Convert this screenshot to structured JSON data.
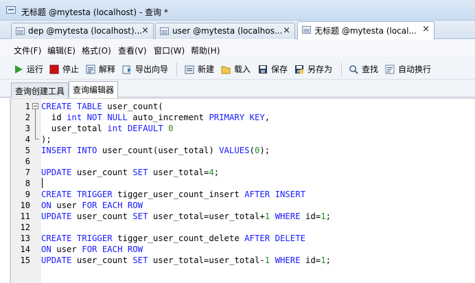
{
  "window": {
    "title": "无标题 @mytesta (localhost) - 查询 *"
  },
  "tabs": [
    {
      "label": "dep @mytesta (localhost)...",
      "close": "×",
      "active": false
    },
    {
      "label": "user @mytesta (localhos...",
      "close": "×",
      "active": false
    },
    {
      "label": "无标题 @mytesta (local...",
      "close": "×",
      "active": true
    }
  ],
  "menu": [
    {
      "label": "文件(F)"
    },
    {
      "label": "编辑(E)"
    },
    {
      "label": "格式(O)"
    },
    {
      "label": "查看(V)"
    },
    {
      "label": "窗口(W)"
    },
    {
      "label": "帮助(H)"
    }
  ],
  "toolbar": {
    "run": "运行",
    "stop": "停止",
    "explain": "解释",
    "export_wizard": "导出向导",
    "new": "新建",
    "load": "载入",
    "save": "保存",
    "save_as": "另存为",
    "find": "查找",
    "word_wrap": "自动换行"
  },
  "sub_tabs": [
    {
      "label": "查询创建工具",
      "active": false
    },
    {
      "label": "查询编辑器",
      "active": true
    }
  ],
  "colors": {
    "keyword": "#1a1aff",
    "number": "#1b8c1b",
    "run_icon": "#2f9e2f",
    "stop_icon": "#d01010"
  },
  "editor": {
    "lines": [
      {
        "n": "1",
        "tokens": [
          [
            "kw",
            "CREATE TABLE "
          ],
          [
            "plain",
            "user_count("
          ]
        ]
      },
      {
        "n": "2",
        "tokens": [
          [
            "plain",
            "  id "
          ],
          [
            "kw",
            "int NOT NULL "
          ],
          [
            "plain",
            "auto_increment "
          ],
          [
            "kw",
            "PRIMARY KEY"
          ],
          [
            "plain",
            ","
          ]
        ]
      },
      {
        "n": "3",
        "tokens": [
          [
            "plain",
            "  user_total "
          ],
          [
            "kw",
            "int DEFAULT "
          ],
          [
            "num",
            "0"
          ]
        ]
      },
      {
        "n": "4",
        "tokens": [
          [
            "plain",
            ");"
          ]
        ]
      },
      {
        "n": "5",
        "tokens": [
          [
            "kw",
            "INSERT INTO "
          ],
          [
            "plain",
            "user_count(user_total) "
          ],
          [
            "kw",
            "VALUES"
          ],
          [
            "plain",
            "("
          ],
          [
            "num",
            "0"
          ],
          [
            "plain",
            ");"
          ]
        ]
      },
      {
        "n": "6",
        "tokens": []
      },
      {
        "n": "7",
        "tokens": [
          [
            "kw",
            "UPDATE "
          ],
          [
            "plain",
            "user_count "
          ],
          [
            "kw",
            "SET "
          ],
          [
            "plain",
            "user_total="
          ],
          [
            "num",
            "4"
          ],
          [
            "plain",
            ";"
          ]
        ]
      },
      {
        "n": "8",
        "tokens": []
      },
      {
        "n": "9",
        "tokens": [
          [
            "kw",
            "CREATE TRIGGER "
          ],
          [
            "plain",
            "tigger_user_count_insert "
          ],
          [
            "kw",
            "AFTER INSERT"
          ]
        ]
      },
      {
        "n": "10",
        "tokens": [
          [
            "kw",
            "ON "
          ],
          [
            "plain",
            "user "
          ],
          [
            "kw",
            "FOR EACH ROW"
          ]
        ]
      },
      {
        "n": "11",
        "tokens": [
          [
            "kw",
            "UPDATE "
          ],
          [
            "plain",
            "user_count "
          ],
          [
            "kw",
            "SET "
          ],
          [
            "plain",
            "user_total=user_total+"
          ],
          [
            "num",
            "1"
          ],
          [
            "plain",
            " "
          ],
          [
            "kw",
            "WHERE "
          ],
          [
            "plain",
            "id="
          ],
          [
            "num",
            "1"
          ],
          [
            "plain",
            ";"
          ]
        ]
      },
      {
        "n": "12",
        "tokens": []
      },
      {
        "n": "13",
        "tokens": [
          [
            "kw",
            "CREATE TRIGGER "
          ],
          [
            "plain",
            "tigger_user_count_delete "
          ],
          [
            "kw",
            "AFTER DELETE"
          ]
        ]
      },
      {
        "n": "14",
        "tokens": [
          [
            "kw",
            "ON "
          ],
          [
            "plain",
            "user "
          ],
          [
            "kw",
            "FOR EACH ROW"
          ]
        ]
      },
      {
        "n": "15",
        "tokens": [
          [
            "kw",
            "UPDATE "
          ],
          [
            "plain",
            "user_count "
          ],
          [
            "kw",
            "SET "
          ],
          [
            "plain",
            "user_total=user_total-"
          ],
          [
            "num",
            "1"
          ],
          [
            "plain",
            " "
          ],
          [
            "kw",
            "WHERE "
          ],
          [
            "plain",
            "id="
          ],
          [
            "num",
            "1"
          ],
          [
            "plain",
            ";"
          ]
        ]
      }
    ]
  }
}
